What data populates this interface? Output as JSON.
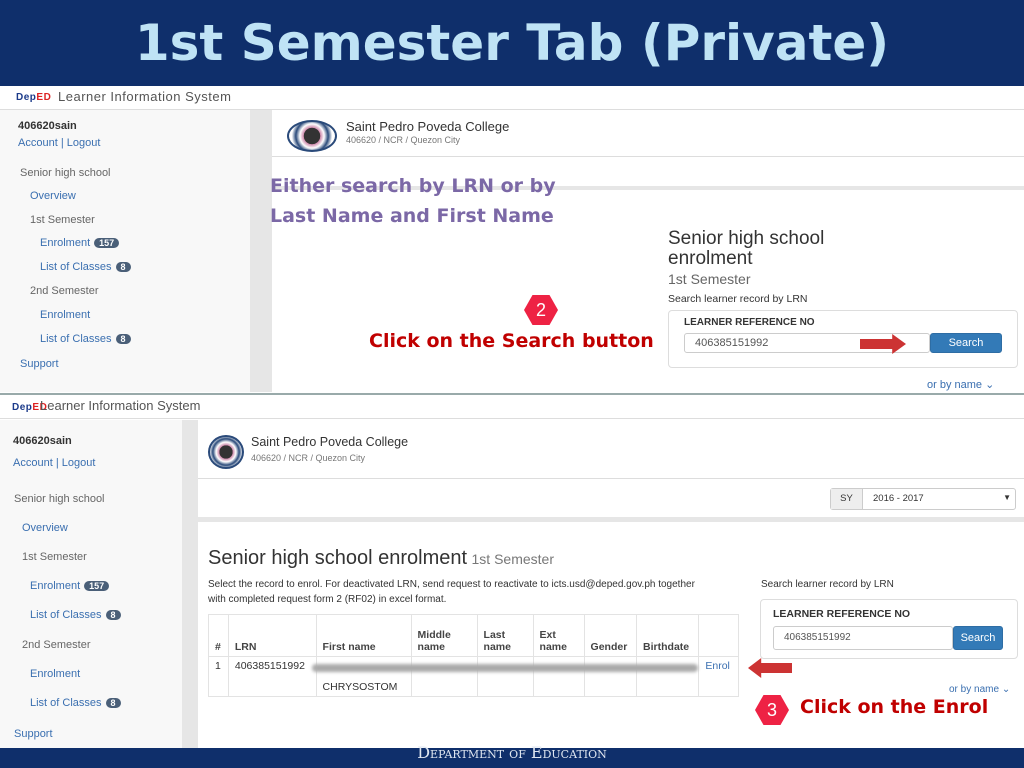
{
  "slide": {
    "title": "1st Semester Tab (Private)",
    "footer": "Department of Education"
  },
  "app": {
    "title": "Learner Information System",
    "logo": "DepED"
  },
  "user": {
    "name": "406620sain",
    "account": "Account",
    "logout": "Logout",
    "sep": "|"
  },
  "sidebar": {
    "section": "Senior high school",
    "overview": "Overview",
    "sem1": "1st Semester",
    "sem1_enrolment": "Enrolment",
    "sem1_enrolment_count": "157",
    "sem1_classes": "List of Classes",
    "sem1_classes_count": "8",
    "sem2": "2nd Semester",
    "sem2_enrolment": "Enrolment",
    "sem2_classes": "List of Classes",
    "sem2_classes_count": "8",
    "support": "Support"
  },
  "school": {
    "name": "Saint Pedro Poveda College",
    "sub": "406620 / NCR / Quezon City"
  },
  "top": {
    "heading1": "Senior high school",
    "heading2": "enrolment",
    "semester": "1st Semester",
    "search_label": "Search learner record by LRN",
    "lrn_label": "LEARNER REFERENCE NO",
    "lrn_value": "406385151992",
    "search_button": "Search",
    "or_by_name": "or by name"
  },
  "notes": {
    "either": "Either search by LRN or by",
    "either2": "Last Name and First Name",
    "step2": "2",
    "click_search": "Click on the Search button",
    "step3": "3",
    "click_enrol": "Click on the Enrol"
  },
  "bottom": {
    "sy_label": "SY",
    "sy_value": "2016 - 2017",
    "heading": "Senior high school enrolment",
    "semester": "1st Semester",
    "instr1": "Select the record to enrol. For deactivated LRN, send request to reactivate to icts.usd@deped.gov.ph together",
    "instr2": "with completed request form 2 (RF02) in excel format.",
    "search_label": "Search learner record by LRN",
    "lrn_label": "LEARNER REFERENCE NO",
    "lrn_value": "406385151992",
    "search_button": "Search",
    "or_by_name": "or by name",
    "columns": [
      "#",
      "LRN",
      "First name",
      "Middle name",
      "Last name",
      "Ext name",
      "Gender",
      "Birthdate",
      ""
    ],
    "row": {
      "num": "1",
      "lrn": "406385151992",
      "first_name": "CHRYSOSTOM",
      "action": "Enrol"
    }
  },
  "colors": {
    "slide_blue": "#0f2f6b",
    "title_text": "#bfe3f5",
    "note_purple": "#7b68a6",
    "note_red": "#c00000",
    "link": "#3a6fb0",
    "button": "#337ab7"
  }
}
